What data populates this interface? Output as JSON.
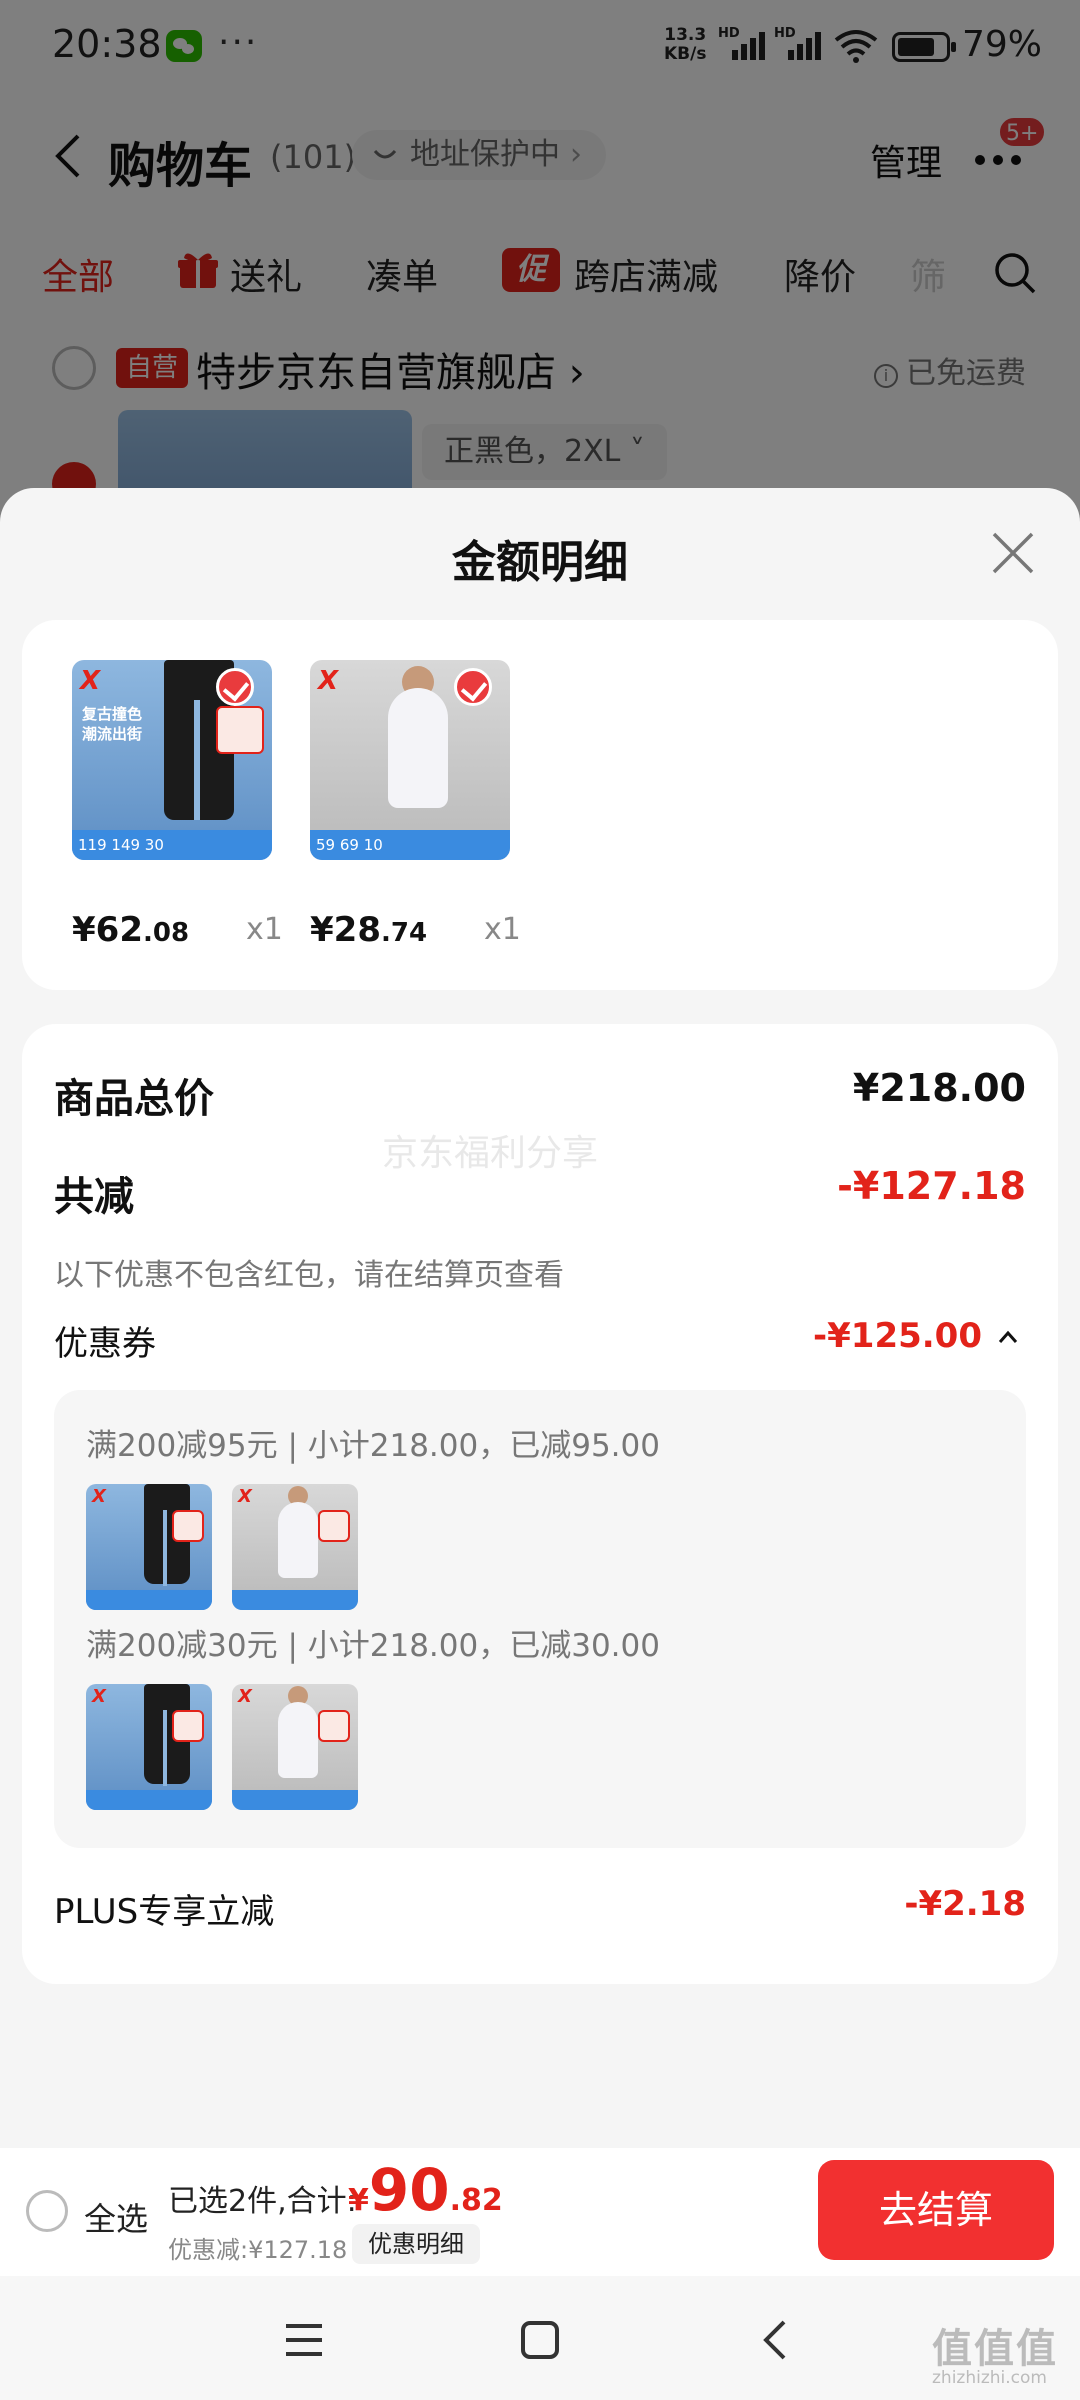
{
  "status_bar": {
    "time": "20:38",
    "more": "···",
    "net_speed_value": "13.3",
    "net_speed_unit": "KB/s",
    "sim_label": "HD",
    "battery": "79%",
    "battery_level": 0.79,
    "icons": [
      "wechat-icon",
      "signal-icon",
      "wifi-icon",
      "battery-icon"
    ]
  },
  "header": {
    "title": "购物车",
    "count": "(101)",
    "address_protect": "地址保护中",
    "manage": "管理",
    "badge": "5+"
  },
  "tabs": [
    {
      "label": "全部",
      "active": true
    },
    {
      "label": "送礼"
    },
    {
      "label": "凑单"
    },
    {
      "label": "跨店满减",
      "badge": "促"
    },
    {
      "label": "降价"
    },
    {
      "label": "筛"
    }
  ],
  "store": {
    "badge": "自营",
    "name": "特步京东自营旗舰店",
    "shipping": "已免运费",
    "variant": "正黑色，2XL"
  },
  "sheet": {
    "title": "金额明细",
    "products": [
      {
        "price_int": "¥62",
        "price_dec": ".08",
        "qty": "x1",
        "image": "black-pants",
        "thumb_text": "复古撞色\n潮流出街",
        "strip": "119  149  30"
      },
      {
        "price_int": "¥28",
        "price_dec": ".74",
        "qty": "x1",
        "image": "white-tee-woman",
        "thumb_text": "",
        "strip": "59  69  10"
      }
    ],
    "total_label": "商品总价",
    "total_value": "¥218.00",
    "reduce_label": "共减",
    "reduce_value": "-¥127.18",
    "note": "以下优惠不包含红包，请在结算页查看",
    "coupon_label": "优惠券",
    "coupon_value": "-¥125.00",
    "coupon_rules": [
      "满200减95元 | 小计218.00，已减95.00",
      "满200减30元 | 小计218.00，已减30.00"
    ],
    "plus_label": "PLUS专享立减",
    "plus_value": "-¥2.18",
    "watermark": "京东福利分享"
  },
  "checkout": {
    "select_all": "全选",
    "selected_text": "已选2件,合计:",
    "price_currency": "¥",
    "price_int": "90",
    "price_dec": ".82",
    "discount": "优惠减:¥127.18",
    "detail_button": "优惠明细",
    "checkout_button": "去结算"
  },
  "footer": {
    "watermark": "值值值",
    "domain": "zhizhizhi.com"
  },
  "colors": {
    "accent": "#e2231a",
    "checkout": "#f23030",
    "sheet_bg": "#f5f5f5"
  }
}
